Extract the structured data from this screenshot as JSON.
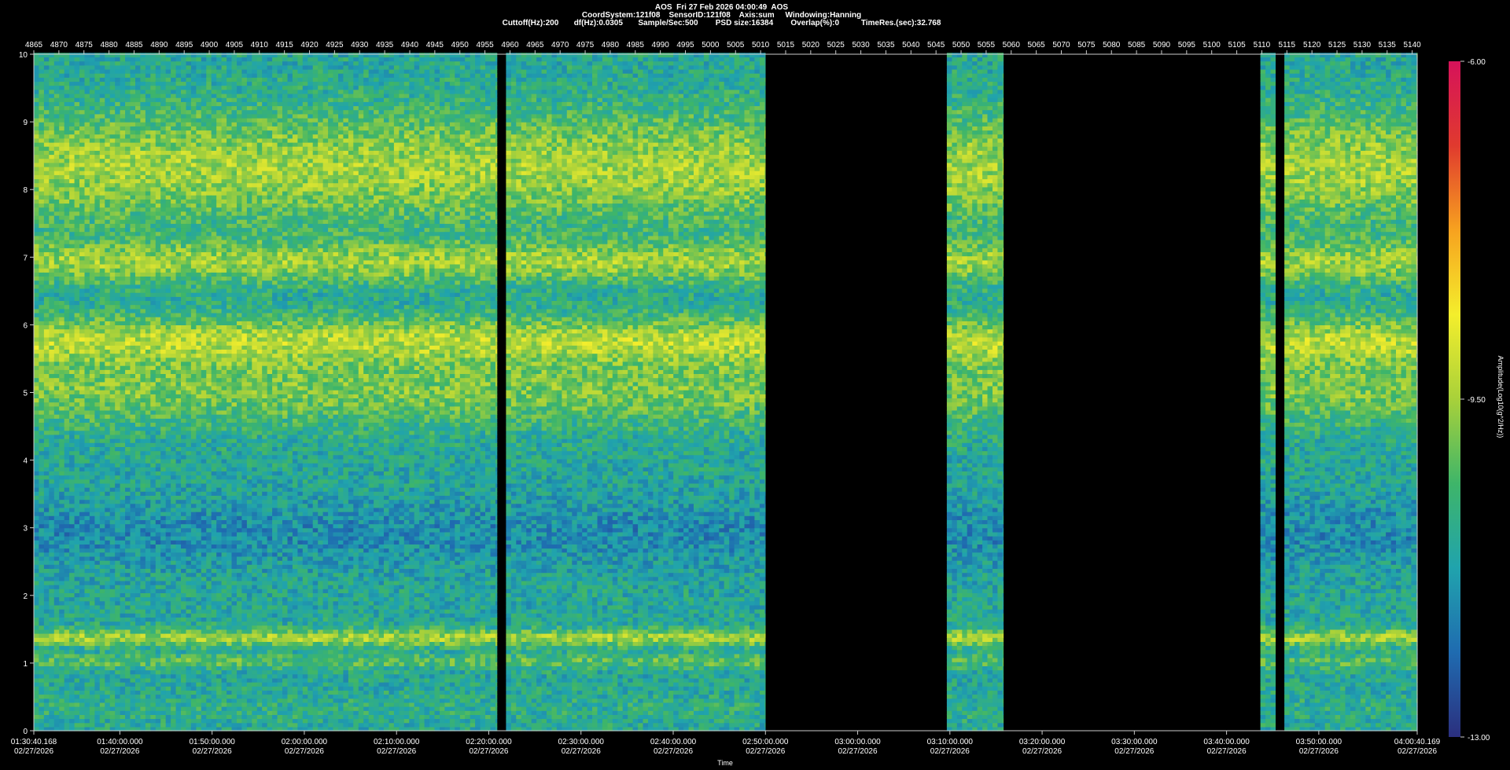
{
  "header": {
    "line1": "AOS  Fri 27 Feb 2026 04:00:49  AOS",
    "line2": "CoordSystem:121f08    SensorID:121f08    Axis:sum     Windowing:Hanning",
    "line3": "Cuttoff(Hz):200       df(Hz):0.0305       Sample/Sec:500        PSD size:16384        Overlap(%):0          TimeRes.(sec):32.768"
  },
  "chart_data": {
    "type": "heatmap",
    "title": "AOS  Fri 27 Feb 2026 04:00:49  AOS",
    "xlabel": "Time",
    "ylabel": "",
    "colorbar_label": "Amplitude(Log10(g^2/Hz))",
    "ylim": [
      0,
      10
    ],
    "y_ticks": [
      "0",
      "1",
      "2",
      "3",
      "4",
      "5",
      "6",
      "7",
      "8",
      "9",
      "10"
    ],
    "top_axis": {
      "range": [
        4865,
        5141
      ],
      "ticks": [
        "4865",
        "4870",
        "4875",
        "4880",
        "4885",
        "4890",
        "4895",
        "4900",
        "4905",
        "4910",
        "4915",
        "4920",
        "4925",
        "4930",
        "4935",
        "4940",
        "4945",
        "4950",
        "4955",
        "4960",
        "4965",
        "4970",
        "4975",
        "4980",
        "4985",
        "4990",
        "4995",
        "5000",
        "5005",
        "5010",
        "5015",
        "5020",
        "5025",
        "5030",
        "5035",
        "5040",
        "5045",
        "5050",
        "5055",
        "5060",
        "5065",
        "5070",
        "5075",
        "5080",
        "5085",
        "5090",
        "5095",
        "5100",
        "5105",
        "5110",
        "5115",
        "5120",
        "5125",
        "5130",
        "5135",
        "5140"
      ]
    },
    "x_range_minutes": [
      0,
      150
    ],
    "x_ticks": [
      {
        "time": "01:30:40.168",
        "date": "02/27/2026",
        "min": 0
      },
      {
        "time": "01:40:00.000",
        "date": "02/27/2026",
        "min": 9.33
      },
      {
        "time": "01:50:00.000",
        "date": "02/27/2026",
        "min": 19.33
      },
      {
        "time": "02:00:00.000",
        "date": "02/27/2026",
        "min": 29.33
      },
      {
        "time": "02:10:00.000",
        "date": "02/27/2026",
        "min": 39.33
      },
      {
        "time": "02:20:00.000",
        "date": "02/27/2026",
        "min": 49.33
      },
      {
        "time": "02:30:00.000",
        "date": "02/27/2026",
        "min": 59.33
      },
      {
        "time": "02:40:00.000",
        "date": "02/27/2026",
        "min": 69.33
      },
      {
        "time": "02:50:00.000",
        "date": "02/27/2026",
        "min": 79.33
      },
      {
        "time": "03:00:00.000",
        "date": "02/27/2026",
        "min": 89.33
      },
      {
        "time": "03:10:00.000",
        "date": "02/27/2026",
        "min": 99.33
      },
      {
        "time": "03:20:00.000",
        "date": "02/27/2026",
        "min": 109.33
      },
      {
        "time": "03:30:00.000",
        "date": "02/27/2026",
        "min": 119.33
      },
      {
        "time": "03:40:00.000",
        "date": "02/27/2026",
        "min": 129.33
      },
      {
        "time": "03:50:00.000",
        "date": "02/27/2026",
        "min": 139.33
      },
      {
        "time": "04:00:40.169",
        "date": "02/27/2026",
        "min": 150
      }
    ],
    "data_segments_minutes": [
      [
        0,
        50.2
      ],
      [
        51.2,
        79.3
      ],
      [
        99.0,
        105.1
      ],
      [
        133.0,
        134.6
      ],
      [
        135.6,
        150
      ]
    ],
    "colorbar": {
      "min": -13.0,
      "max": -6.0,
      "tick_labels": [
        "-6.00",
        "-9.50",
        "-13.00"
      ],
      "colors": [
        "#2b2f7e",
        "#1f6bb0",
        "#20a3ad",
        "#3eb569",
        "#a8d13a",
        "#f4ee2c",
        "#f7a21f",
        "#e03a2e",
        "#d6125a"
      ]
    },
    "bands_hz": [
      {
        "f": 0.3,
        "width": 0.25,
        "level": -10.8
      },
      {
        "f": 1.0,
        "width": 0.1,
        "level": -10.2
      },
      {
        "f": 1.35,
        "width": 0.12,
        "level": -9.5
      },
      {
        "f": 2.9,
        "width": 0.5,
        "level": -11.6
      },
      {
        "f": 5.0,
        "width": 0.5,
        "level": -9.9
      },
      {
        "f": 5.75,
        "width": 0.35,
        "level": -9.4
      },
      {
        "f": 6.9,
        "width": 0.3,
        "level": -9.6
      },
      {
        "f": 8.3,
        "width": 0.8,
        "level": -9.5
      }
    ]
  }
}
